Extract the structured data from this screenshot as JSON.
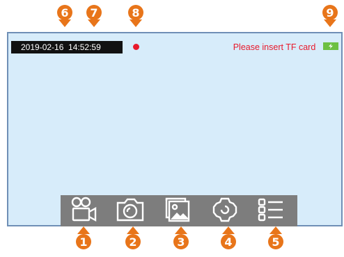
{
  "status_bar": {
    "datetime": "2019-02-16  14:52:59",
    "tf_message": "Please insert TF card",
    "recording_indicator_color": "#e8192c",
    "battery_color": "#6dc042"
  },
  "toolbar": {
    "buttons": [
      {
        "icon": "video-camera-icon"
      },
      {
        "icon": "camera-icon"
      },
      {
        "icon": "gallery-icon"
      },
      {
        "icon": "settings-gear-icon"
      },
      {
        "icon": "menu-list-icon"
      }
    ]
  },
  "callouts": {
    "numbers": [
      "1",
      "2",
      "3",
      "4",
      "5",
      "6",
      "7",
      "8",
      "9"
    ],
    "color": "#e8751a"
  },
  "colors": {
    "screen_bg": "#d7ecfa",
    "screen_border": "#6f8fb6",
    "toolbar_bg": "#7d7d7d",
    "tf_message_color": "#e8192c"
  }
}
